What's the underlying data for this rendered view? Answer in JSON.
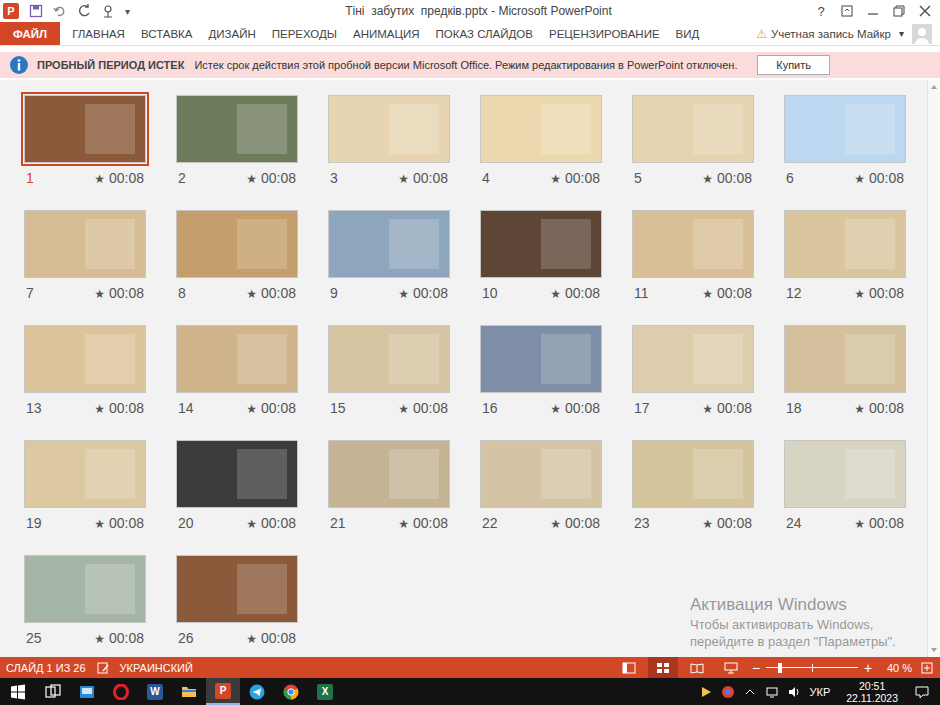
{
  "window": {
    "title": "Тіні  забутих  предків.pptx - Microsoft PowerPoint",
    "app_glyph": "P",
    "help": "?",
    "qat_more": "▾"
  },
  "ribbon": {
    "tabs": [
      {
        "label": "ФАЙЛ",
        "kind": "file",
        "selected": false
      },
      {
        "label": "ГЛАВНАЯ",
        "kind": "tab",
        "selected": false
      },
      {
        "label": "ВСТАВКА",
        "kind": "tab",
        "selected": false
      },
      {
        "label": "ДИЗАЙН",
        "kind": "tab",
        "selected": false
      },
      {
        "label": "ПЕРЕХОДЫ",
        "kind": "tab",
        "selected": false
      },
      {
        "label": "АНИМАЦИЯ",
        "kind": "tab",
        "selected": false
      },
      {
        "label": "ПОКАЗ СЛАЙДОВ",
        "kind": "tab",
        "selected": false
      },
      {
        "label": "РЕЦЕНЗИРОВАНИЕ",
        "kind": "tab",
        "selected": false
      },
      {
        "label": "ВИД",
        "kind": "tab",
        "selected": false
      }
    ],
    "account": {
      "warning": "⚠",
      "label": "Учетная запись Майкр",
      "caret": "▾"
    }
  },
  "message_bar": {
    "title": "ПРОБНЫЙ ПЕРИОД ИСТЕК",
    "text": "Истек срок действия этой пробной версии Microsoft Office. Режим редактирования в PowerPoint отключен.",
    "button": "Купить"
  },
  "slides": [
    {
      "number": "1",
      "mark": "★",
      "time": "00:08",
      "selected": true,
      "color": "#8a5a3a"
    },
    {
      "number": "2",
      "mark": "★",
      "time": "00:08",
      "selected": false,
      "color": "#6e7c5c"
    },
    {
      "number": "3",
      "mark": "★",
      "time": "00:08",
      "selected": false,
      "color": "#e6d5b0"
    },
    {
      "number": "4",
      "mark": "★",
      "time": "00:08",
      "selected": false,
      "color": "#ecd8ae"
    },
    {
      "number": "5",
      "mark": "★",
      "time": "00:08",
      "selected": false,
      "color": "#e6d4b0"
    },
    {
      "number": "6",
      "mark": "★",
      "time": "00:08",
      "selected": false,
      "color": "#bcd8f0"
    },
    {
      "number": "7",
      "mark": "★",
      "time": "00:08",
      "selected": false,
      "color": "#d6bc94"
    },
    {
      "number": "8",
      "mark": "★",
      "time": "00:08",
      "selected": false,
      "color": "#c49e6c"
    },
    {
      "number": "9",
      "mark": "★",
      "time": "00:08",
      "selected": false,
      "color": "#8ea6bc"
    },
    {
      "number": "10",
      "mark": "★",
      "time": "00:08",
      "selected": false,
      "color": "#5e4636"
    },
    {
      "number": "11",
      "mark": "★",
      "time": "00:08",
      "selected": false,
      "color": "#d8bf96"
    },
    {
      "number": "12",
      "mark": "★",
      "time": "00:08",
      "selected": false,
      "color": "#dac69e"
    },
    {
      "number": "13",
      "mark": "★",
      "time": "00:08",
      "selected": false,
      "color": "#dcc49c"
    },
    {
      "number": "14",
      "mark": "★",
      "time": "00:08",
      "selected": false,
      "color": "#d0b48c"
    },
    {
      "number": "15",
      "mark": "★",
      "time": "00:08",
      "selected": false,
      "color": "#d6c4a2"
    },
    {
      "number": "16",
      "mark": "★",
      "time": "00:08",
      "selected": false,
      "color": "#7e8ea6"
    },
    {
      "number": "17",
      "mark": "★",
      "time": "00:08",
      "selected": false,
      "color": "#ddcdad"
    },
    {
      "number": "18",
      "mark": "★",
      "time": "00:08",
      "selected": false,
      "color": "#d4c09c"
    },
    {
      "number": "19",
      "mark": "★",
      "time": "00:08",
      "selected": false,
      "color": "#dcc9a2"
    },
    {
      "number": "20",
      "mark": "★",
      "time": "00:08",
      "selected": false,
      "color": "#3c3c3a"
    },
    {
      "number": "21",
      "mark": "★",
      "time": "00:08",
      "selected": false,
      "color": "#c4b494"
    },
    {
      "number": "22",
      "mark": "★",
      "time": "00:08",
      "selected": false,
      "color": "#d4c4a4"
    },
    {
      "number": "23",
      "mark": "★",
      "time": "00:08",
      "selected": false,
      "color": "#d4c49c"
    },
    {
      "number": "24",
      "mark": "★",
      "time": "00:08",
      "selected": false,
      "color": "#d8d4c4"
    },
    {
      "number": "25",
      "mark": "★",
      "time": "00:08",
      "selected": false,
      "color": "#a6b6a6"
    },
    {
      "number": "26",
      "mark": "★",
      "time": "00:08",
      "selected": false,
      "color": "#8a5a3a"
    }
  ],
  "watermark": {
    "title": "Активация Windows",
    "lines": [
      "Чтобы активировать Windows,",
      "перейдите в раздел \"Параметры\"."
    ]
  },
  "status_bar": {
    "slide": "СЛАЙД 1 ИЗ 26",
    "language": "УКРАИНСКИЙ",
    "views": [
      {
        "kind": "normal",
        "selected": false
      },
      {
        "kind": "sorter",
        "selected": true
      },
      {
        "kind": "reading",
        "selected": false
      },
      {
        "kind": "show",
        "selected": false
      }
    ],
    "zoom": {
      "minus": "−",
      "plus": "+",
      "level": 0.15,
      "reading": "40 %"
    }
  },
  "taskbar": {
    "apps": [
      {
        "kind": "search",
        "glyph": "",
        "color": "#ffffff",
        "active": false
      },
      {
        "kind": "app",
        "glyph": "",
        "color": "#2a8ad4",
        "active": false
      },
      {
        "kind": "opera",
        "glyph": "",
        "color": "#e0202a",
        "active": false
      },
      {
        "kind": "app",
        "glyph": "W",
        "color": "#2b579a",
        "active": false
      },
      {
        "kind": "folder",
        "glyph": "",
        "color": "#f2c14e",
        "active": false
      },
      {
        "kind": "app",
        "glyph": "P",
        "color": "#d24726",
        "active": true
      },
      {
        "kind": "telegram",
        "glyph": "",
        "color": "#2aa3df",
        "active": false
      },
      {
        "kind": "chrome",
        "glyph": "",
        "color": "#2f9e44",
        "active": false
      },
      {
        "kind": "app",
        "glyph": "X",
        "color": "#217346",
        "active": false
      }
    ],
    "language": "УКР",
    "time": "20:51",
    "date": "22.11.2023"
  }
}
